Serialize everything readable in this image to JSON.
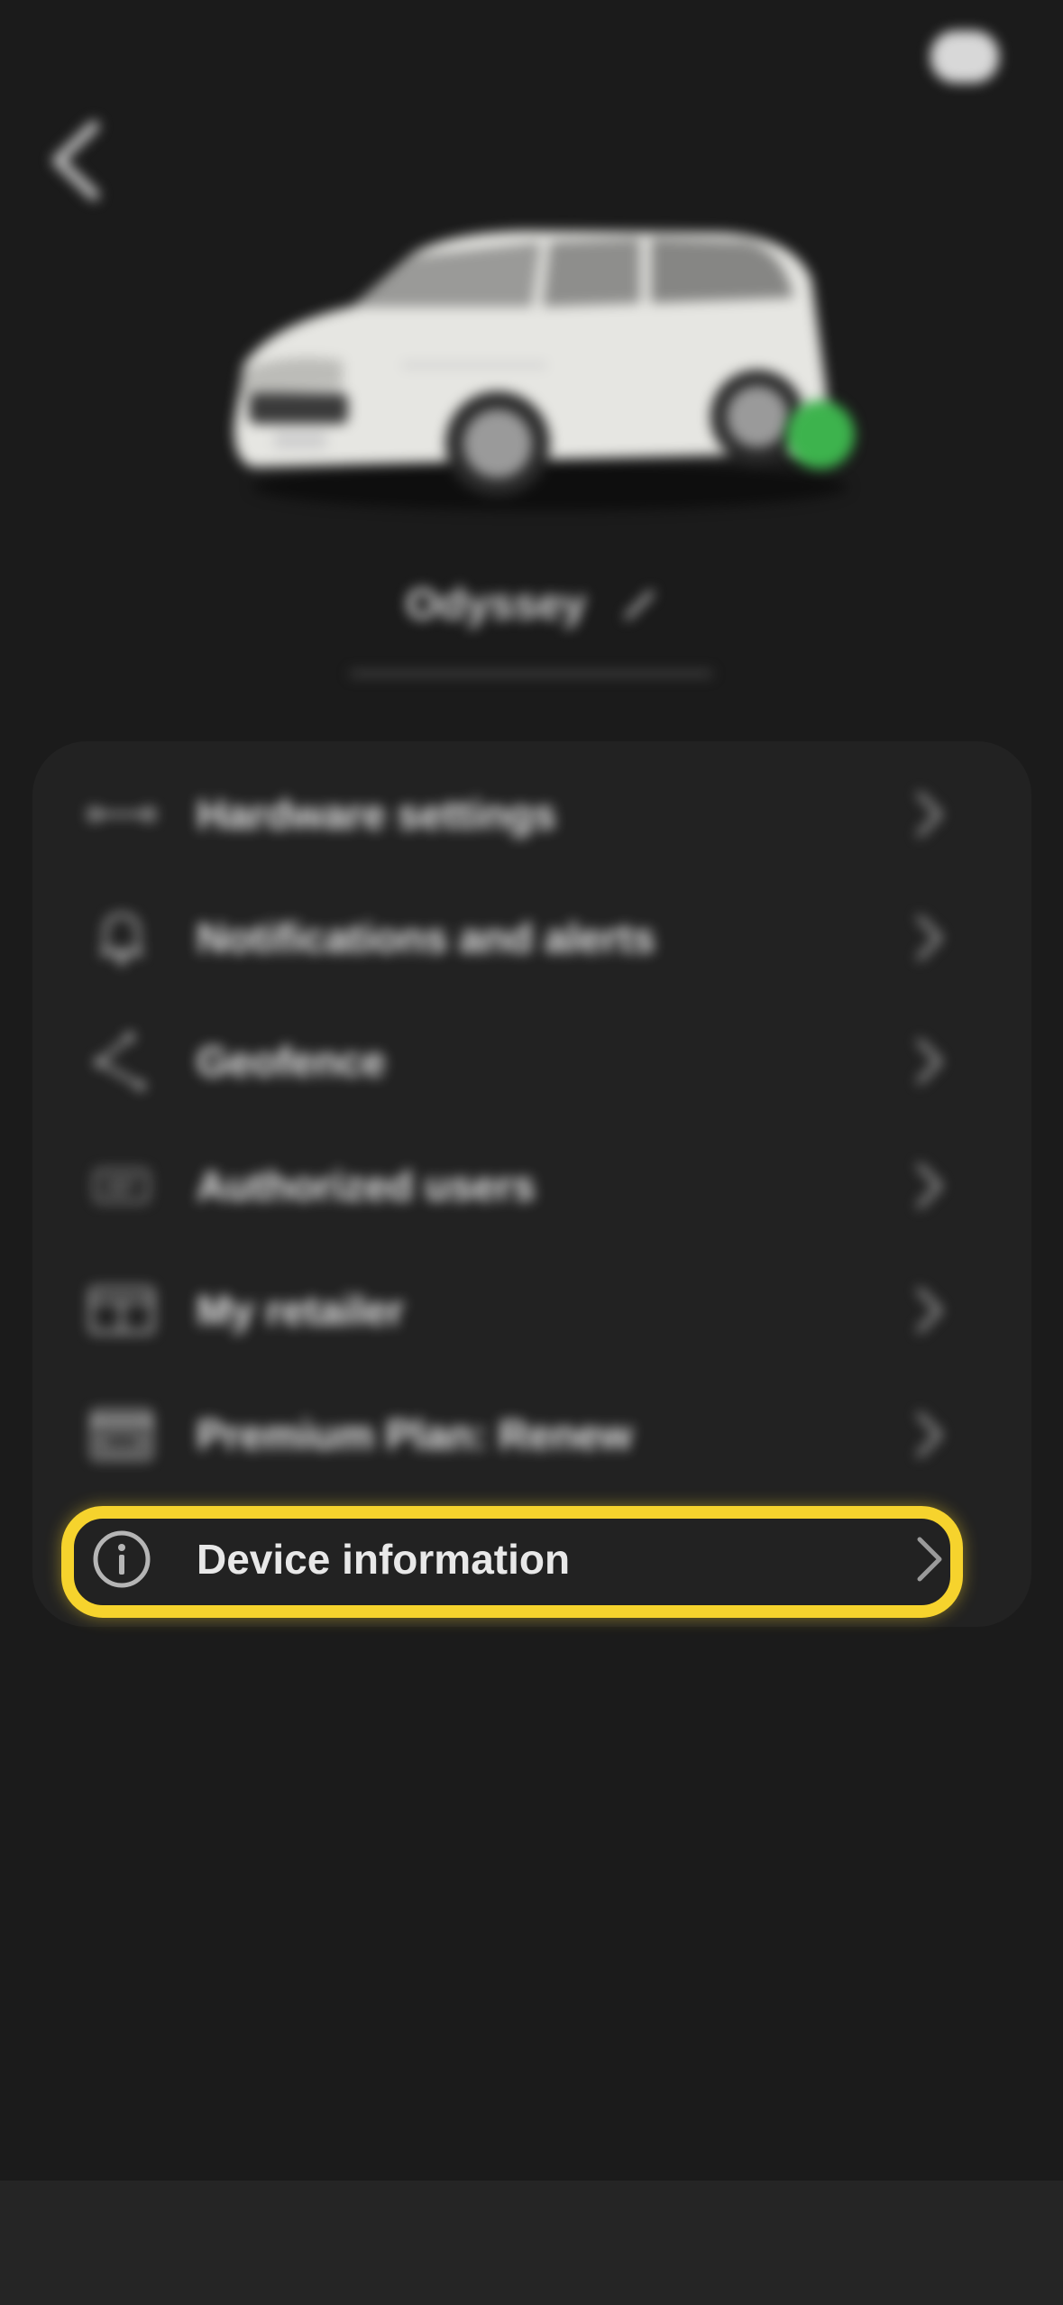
{
  "header": {
    "back_icon": "chevron-left-icon",
    "top_right_badge": "help-badge"
  },
  "vehicle": {
    "name": "Odyssey",
    "image": "white-minivan",
    "status_color": "#3db34d",
    "edit_icon": "pencil-icon"
  },
  "menu": {
    "items": [
      {
        "label": "Hardware settings",
        "icon": "hardware-icon"
      },
      {
        "label": "Notifications and alerts",
        "icon": "bell-icon"
      },
      {
        "label": "Geofence",
        "icon": "geofence-icon"
      },
      {
        "label": "Authorized users",
        "icon": "users-icon"
      },
      {
        "label": "My retailer",
        "icon": "retailer-icon"
      },
      {
        "label": "Premium Plan: Renew",
        "icon": "card-icon"
      },
      {
        "label": "Device information",
        "icon": "info-icon"
      }
    ],
    "highlighted_index": 6
  },
  "colors": {
    "background": "#1b1b1b",
    "card": "#222222",
    "highlight": "#f6d32d"
  }
}
